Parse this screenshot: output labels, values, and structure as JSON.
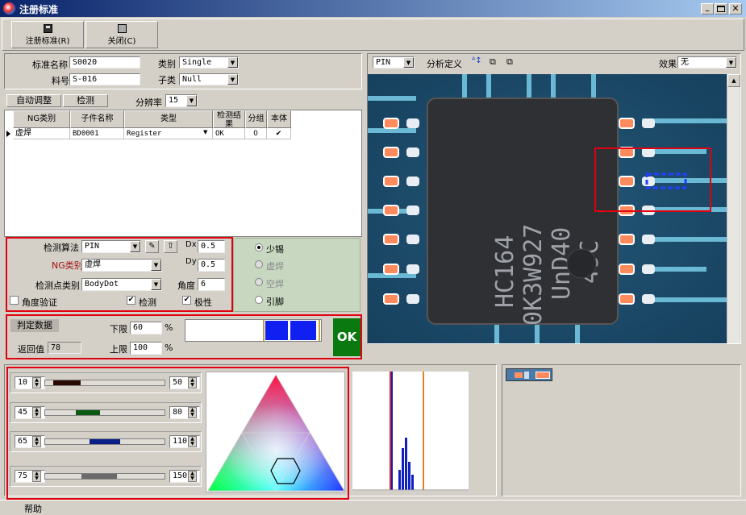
{
  "window": {
    "title": "注册标准"
  },
  "toolbar": {
    "register_label": "注册标准(R)",
    "close_label": "关闭(C)"
  },
  "info": {
    "std_name_label": "标准名称",
    "std_name_value": "S0020",
    "part_no_label": "料号",
    "part_no_value": "S-016",
    "category_label": "类别",
    "category_value": "Single",
    "subcategory_label": "子类",
    "subcategory_value": "Null"
  },
  "actions": {
    "auto_adjust": "自动调整",
    "detect": "检测",
    "resolution_label": "分辨率",
    "resolution_value": "15"
  },
  "grid": {
    "headers": [
      "NG类别",
      "子件名称",
      "类型",
      "检测结果",
      "分组",
      "本体"
    ],
    "rows": [
      [
        "虚焊",
        "BD0001",
        "Register",
        "OK",
        "0",
        "✔"
      ]
    ]
  },
  "params": {
    "algo_label": "检测算法",
    "algo_value": "PIN",
    "ng_label": "NG类别",
    "ng_value": "虚焊",
    "pointtype_label": "检测点类别",
    "pointtype_value": "BodyDot",
    "dx_label": "Dx",
    "dx_value": "0.5",
    "dy_label": "Dy",
    "dy_value": "0.5",
    "angle_label": "角度",
    "angle_value": "6",
    "angle_verify_label": "角度验证",
    "detect_label": "检测",
    "polarity_label": "极性",
    "radio_less_tin": "少锡",
    "radio_virtual": "虚焊",
    "radio_empty": "空焊",
    "radio_pin": "引脚"
  },
  "judge": {
    "tab_label": "判定数据",
    "return_label": "返回值",
    "return_value": "78",
    "lower_label": "下限",
    "lower_value": "60",
    "upper_label": "上限",
    "upper_value": "100",
    "unit": "%",
    "result": "OK"
  },
  "sliders": [
    {
      "low": "10",
      "high": "50",
      "fill": "#2a0a00"
    },
    {
      "low": "45",
      "high": "80",
      "fill": "#0b5a10"
    },
    {
      "low": "65",
      "high": "110",
      "fill": "#0a1e88"
    },
    {
      "low": "75",
      "high": "150",
      "fill": "#6a6a6a"
    }
  ],
  "view": {
    "mode_value": "PIN",
    "analysis_label": "分析定义",
    "effect_label": "效果",
    "effect_value": "无"
  },
  "chip": {
    "line1": "HC164",
    "line2": "0K3W927",
    "line3": "UnD40",
    "line4": "49C"
  },
  "status": {
    "help_label": "帮助"
  },
  "colors": {
    "red": "#e00010",
    "ok_green": "#0a7a10",
    "titlebar": "#0a246a"
  }
}
